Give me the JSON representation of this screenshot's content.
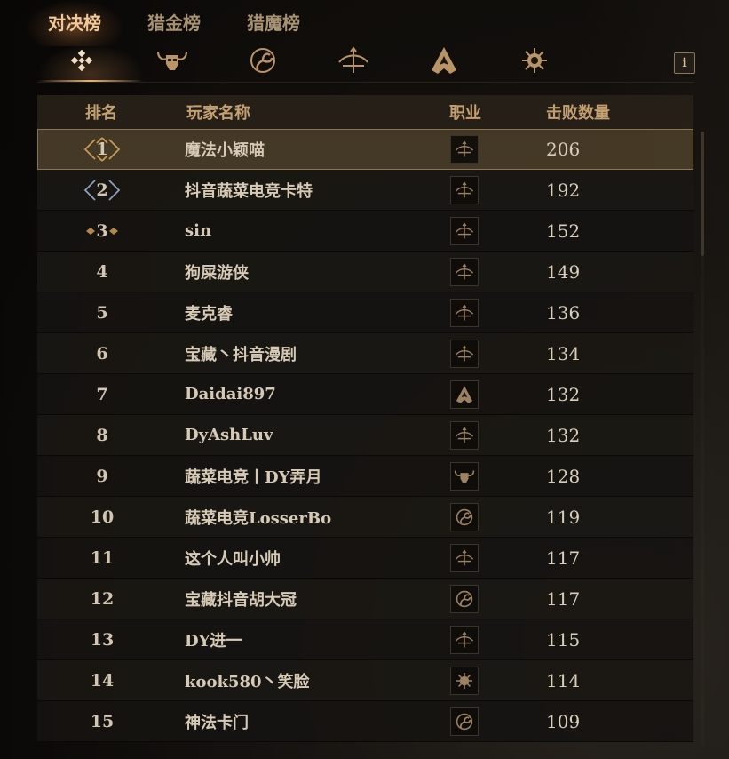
{
  "tabs": [
    {
      "label": "对决榜",
      "active": true
    },
    {
      "label": "猎金榜",
      "active": false
    },
    {
      "label": "猎魔榜",
      "active": false
    }
  ],
  "class_filters": [
    {
      "icon": "all-classes-diamond-icon",
      "active": true
    },
    {
      "icon": "barbarian-helm-icon",
      "active": false
    },
    {
      "icon": "triskelion-icon",
      "active": false
    },
    {
      "icon": "bow-icon",
      "active": false
    },
    {
      "icon": "hooded-figure-icon",
      "active": false
    },
    {
      "icon": "sun-icon",
      "active": false
    }
  ],
  "info_label": "i",
  "table": {
    "headers": {
      "rank": "排名",
      "name": "玩家名称",
      "class": "职业",
      "kills": "击败数量"
    },
    "rows": [
      {
        "rank": "1",
        "name": "魔法小颖喵",
        "class_icon": "bow-icon",
        "kills": "206",
        "medal": "gold",
        "highlight": true
      },
      {
        "rank": "2",
        "name": "抖音蔬菜电竞卡特",
        "class_icon": "bow-icon",
        "kills": "192",
        "medal": "silver"
      },
      {
        "rank": "3",
        "name": "sin",
        "class_icon": "bow-icon",
        "kills": "152",
        "medal": "bronze"
      },
      {
        "rank": "4",
        "name": "狗屎游侠",
        "class_icon": "bow-icon",
        "kills": "149"
      },
      {
        "rank": "5",
        "name": "麦克睿",
        "class_icon": "bow-icon",
        "kills": "136"
      },
      {
        "rank": "6",
        "name": "宝藏丶抖音漫剧",
        "class_icon": "bow-icon",
        "kills": "134"
      },
      {
        "rank": "7",
        "name": "Daidai897",
        "class_icon": "hooded-figure-icon",
        "kills": "132"
      },
      {
        "rank": "8",
        "name": "DyAshLuv",
        "class_icon": "bow-icon",
        "kills": "132"
      },
      {
        "rank": "9",
        "name": "蔬菜电竞丨DY弄月",
        "class_icon": "barbarian-helm-icon",
        "kills": "128"
      },
      {
        "rank": "10",
        "name": "蔬菜电竞LosserBo",
        "class_icon": "triskelion-icon",
        "kills": "119"
      },
      {
        "rank": "11",
        "name": "这个人叫小帅",
        "class_icon": "bow-icon",
        "kills": "117"
      },
      {
        "rank": "12",
        "name": "宝藏抖音胡大冠",
        "class_icon": "triskelion-icon",
        "kills": "117"
      },
      {
        "rank": "13",
        "name": "DY进一",
        "class_icon": "bow-icon",
        "kills": "115"
      },
      {
        "rank": "14",
        "name": "kook580丶笑脸",
        "class_icon": "sun-icon",
        "kills": "114"
      },
      {
        "rank": "15",
        "name": "神法卡门",
        "class_icon": "triskelion-icon",
        "kills": "109"
      }
    ]
  },
  "colors": {
    "accent": "#f1c89a",
    "gold_medal": "#c99a52",
    "silver_medal": "#8ea0c0",
    "bronze_medal": "#b48648",
    "icon_gold": "#b89466"
  }
}
